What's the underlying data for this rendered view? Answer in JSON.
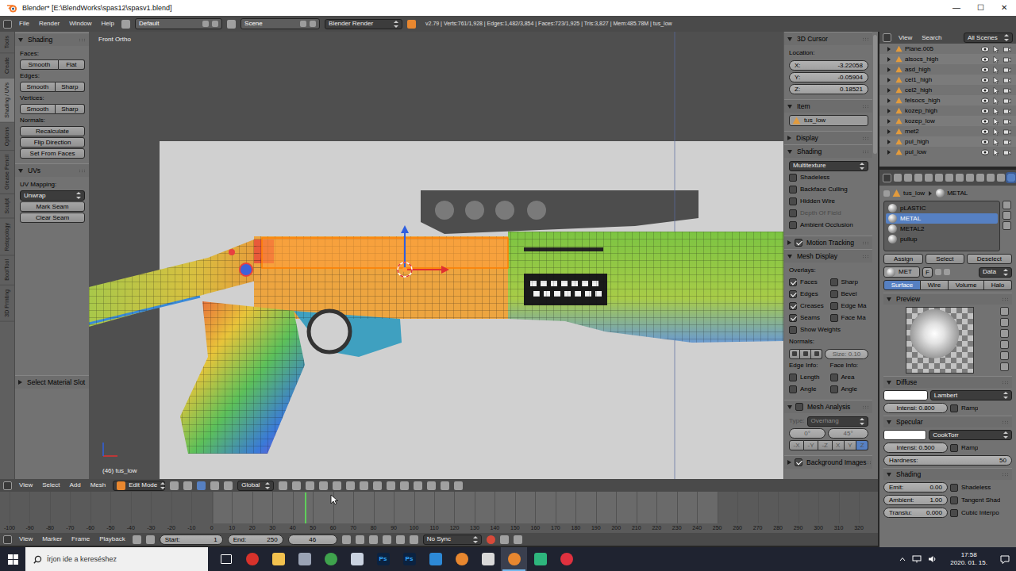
{
  "window": {
    "title": "Blender* [E:\\BlendWorks\\spas12\\spasv1.blend]",
    "controls": [
      "—",
      "☐",
      "✕"
    ]
  },
  "info_header": {
    "menus": [
      "File",
      "Render",
      "Window",
      "Help"
    ],
    "screen_layout": "Default",
    "scene": "Scene",
    "engine": "Blender Render",
    "stats": "v2.79 | Verts:761/1,928 | Edges:1,482/3,854 | Faces:723/1,925 | Tris:3,827 | Mem:485.78M | tus_low"
  },
  "tool_shelf": {
    "tabs": [
      {
        "label": "Tools",
        "selected": false
      },
      {
        "label": "Create",
        "selected": false
      },
      {
        "label": "Shading / UVs",
        "selected": true
      },
      {
        "label": "Options",
        "selected": false
      },
      {
        "label": "Grease Pencil",
        "selected": false
      },
      {
        "label": "Sculpt",
        "selected": false
      },
      {
        "label": "Retopology",
        "selected": false
      },
      {
        "label": "BoolTool",
        "selected": false
      },
      {
        "label": "3D Printing",
        "selected": false
      }
    ],
    "panels": [
      {
        "title": "Shading",
        "expanded": true,
        "rows": [
          {
            "kind": "label",
            "text": "Faces:"
          },
          {
            "kind": "buttons",
            "items": [
              "Smooth",
              "Flat"
            ]
          },
          {
            "kind": "label",
            "text": "Edges:"
          },
          {
            "kind": "buttons",
            "items": [
              "Smooth",
              "Sharp"
            ]
          },
          {
            "kind": "label",
            "text": "Vertices:"
          },
          {
            "kind": "buttons",
            "items": [
              "Smooth",
              "Sharp"
            ]
          },
          {
            "kind": "label",
            "text": "Normals:"
          },
          {
            "kind": "button",
            "text": "Recalculate"
          },
          {
            "kind": "button",
            "text": "Flip Direction"
          },
          {
            "kind": "button",
            "text": "Set From Faces"
          }
        ]
      },
      {
        "title": "UVs",
        "expanded": true,
        "rows": [
          {
            "kind": "label",
            "text": "UV Mapping:"
          },
          {
            "kind": "menu",
            "text": "Unwrap"
          },
          {
            "kind": "button",
            "text": "Mark Seam"
          },
          {
            "kind": "button",
            "text": "Clear Seam"
          }
        ]
      }
    ],
    "operator_panel": {
      "title": "Select Material Slot",
      "expanded": false
    }
  },
  "viewport": {
    "view_name": "Front Ortho",
    "object_info": "(46) tus_low"
  },
  "n_panel": {
    "panels": [
      {
        "title": "3D Cursor",
        "expanded": true,
        "rows": [
          {
            "kind": "label",
            "text": "Location:",
            "disabled": false
          },
          {
            "kind": "field",
            "label": "X:",
            "value": "-3.22058",
            "disabled": false
          },
          {
            "kind": "field",
            "label": "Y:",
            "value": "-0.05904",
            "disabled": false
          },
          {
            "kind": "field",
            "label": "Z:",
            "value": "0.18521",
            "disabled": false
          }
        ]
      },
      {
        "title": "Item",
        "expanded": true,
        "rows": [
          {
            "kind": "input",
            "value": "tus_low",
            "disabled": false
          }
        ]
      },
      {
        "title": "Display",
        "expanded": false,
        "rows": []
      },
      {
        "title": "Shading",
        "expanded": true,
        "rows": [
          {
            "kind": "dropdown",
            "value": "Multitexture",
            "disabled": false
          },
          {
            "kind": "check",
            "label": "Shadeless",
            "checked": false,
            "disabled": false
          },
          {
            "kind": "check",
            "label": "Backface Culling",
            "checked": false,
            "disabled": false
          },
          {
            "kind": "check",
            "label": "Hidden Wire",
            "checked": false,
            "disabled": false
          },
          {
            "kind": "check",
            "label": "Depth Of Field",
            "checked": false,
            "disabled": true
          },
          {
            "kind": "check",
            "label": "Ambient Occlusion",
            "checked": false,
            "disabled": false
          }
        ]
      },
      {
        "title": "Motion Tracking",
        "expanded": false,
        "checkbox": {
          "checked": true
        },
        "rows": []
      },
      {
        "title": "Mesh Display",
        "expanded": true,
        "rows": [
          {
            "kind": "label",
            "text": "Overlays:",
            "disabled": false
          },
          {
            "kind": "check2",
            "items": [
              {
                "label": "Faces",
                "checked": true
              },
              {
                "label": "Sharp",
                "checked": false
              }
            ],
            "disabled": false
          },
          {
            "kind": "check2",
            "items": [
              {
                "label": "Edges",
                "checked": true
              },
              {
                "label": "Bevel",
                "checked": false
              }
            ],
            "disabled": false
          },
          {
            "kind": "check2",
            "items": [
              {
                "label": "Creases",
                "checked": true
              },
              {
                "label": "Edge Ma",
                "checked": false
              }
            ],
            "disabled": false
          },
          {
            "kind": "check2",
            "items": [
              {
                "label": "Seams",
                "checked": true
              },
              {
                "label": "Face Ma",
                "checked": false
              }
            ],
            "disabled": false
          },
          {
            "kind": "check",
            "label": "Show Weights",
            "checked": false,
            "disabled": false
          },
          {
            "kind": "label",
            "text": "Normals:",
            "disabled": false
          },
          {
            "kind": "normals",
            "value": "Size: 0.10",
            "disabled": true
          },
          {
            "kind": "pair",
            "items": [
              "Edge Info:",
              "Face Info:"
            ],
            "disabled": false
          },
          {
            "kind": "check2",
            "items": [
              {
                "label": "Length",
                "checked": false
              },
              {
                "label": "Area",
                "checked": false
              }
            ],
            "disabled": false
          },
          {
            "kind": "check2",
            "items": [
              {
                "label": "Angle",
                "checked": false
              },
              {
                "label": "Angle",
                "checked": false
              }
            ],
            "disabled": false
          }
        ]
      },
      {
        "title": "Mesh Analysis",
        "expanded": true,
        "checkbox": {
          "checked": false
        },
        "rows": [
          {
            "kind": "labeled-dropdown",
            "label": "Type:",
            "value": "Overhang",
            "disabled": true
          },
          {
            "kind": "fields2",
            "items": [
              "0°",
              "45°"
            ],
            "disabled": true
          },
          {
            "kind": "buttons",
            "items": [
              {
                "label": "-X",
                "selected": false
              },
              {
                "label": "-Y",
                "selected": false
              },
              {
                "label": "-Z",
                "selected": false
              },
              {
                "label": "X",
                "selected": false
              },
              {
                "label": "Y",
                "selected": false
              },
              {
                "label": "Z",
                "selected": true
              }
            ],
            "disabled": true
          }
        ]
      },
      {
        "title": "Background Images",
        "expanded": false,
        "checkbox": {
          "checked": true
        },
        "rows": []
      }
    ]
  },
  "viewport_header": {
    "menus": [
      "View",
      "Select",
      "Add",
      "Mesh"
    ],
    "mode": "Edit Mode",
    "orientation": "Global"
  },
  "timeline": {
    "ruler": {
      "min": -100,
      "max": 320,
      "ticks": [
        "-100",
        "-90",
        "-80",
        "-70",
        "-60",
        "-50",
        "-40",
        "-30",
        "-20",
        "-10",
        "0",
        "10",
        "20",
        "30",
        "40",
        "50",
        "60",
        "70",
        "80",
        "90",
        "100",
        "110",
        "120",
        "130",
        "140",
        "150",
        "160",
        "170",
        "180",
        "190",
        "200",
        "210",
        "220",
        "230",
        "240",
        "250",
        "260",
        "270",
        "280",
        "290",
        "300",
        "310",
        "320"
      ]
    }
  },
  "timeline_header": {
    "menus": [
      "View",
      "Marker",
      "Frame",
      "Playback"
    ],
    "start_label": "Start:",
    "start": "1",
    "end_label": "End:",
    "end": "250",
    "frame": "46",
    "sync": "No Sync"
  },
  "outliner": {
    "menus": [
      "View",
      "Search"
    ],
    "filter": "All Scenes",
    "items": [
      {
        "name": "Plane.005",
        "expanded": false
      },
      {
        "name": "alsocs_high",
        "expanded": false
      },
      {
        "name": "asd_high",
        "expanded": false
      },
      {
        "name": "cel1_high",
        "expanded": false
      },
      {
        "name": "cel2_high",
        "expanded": false
      },
      {
        "name": "felsocs_high",
        "expanded": false
      },
      {
        "name": "kozep_high",
        "expanded": false
      },
      {
        "name": "kozep_low",
        "expanded": false
      },
      {
        "name": "met2",
        "expanded": false
      },
      {
        "name": "pul_high",
        "expanded": false
      },
      {
        "name": "pul_low",
        "expanded": false
      }
    ]
  },
  "properties": {
    "context_tabs": [
      {
        "selected": false
      },
      {
        "selected": false
      },
      {
        "selected": false
      },
      {
        "selected": false
      },
      {
        "selected": false
      },
      {
        "selected": false
      },
      {
        "selected": false
      },
      {
        "selected": false
      },
      {
        "selected": false
      },
      {
        "selected": false
      },
      {
        "selected": false
      },
      {
        "selected": true
      },
      {
        "selected": false
      }
    ],
    "breadcrumb": {
      "object": "tus_low",
      "material": "METAL"
    },
    "material_slots": [
      {
        "name": "pLASTIC",
        "selected": false
      },
      {
        "name": "METAL",
        "selected": true
      },
      {
        "name": "METAL2",
        "selected": false
      },
      {
        "name": "pullup",
        "selected": false
      }
    ],
    "slot_buttons": [
      "Assign",
      "Select",
      "Deselect"
    ],
    "datablock": {
      "name": "MET",
      "fake_user": "F",
      "link": "Data"
    },
    "material_tabs": [
      {
        "label": "Surface",
        "selected": true
      },
      {
        "label": "Wire",
        "selected": false
      },
      {
        "label": "Volume",
        "selected": false
      },
      {
        "label": "Halo",
        "selected": false
      }
    ],
    "preview": {
      "title": "Preview",
      "expanded": true
    },
    "diffuse": {
      "title": "Diffuse",
      "expanded": true,
      "shader": "Lambert",
      "intensity": "Intensi: 0.800",
      "ramp": {
        "label": "Ramp",
        "checked": false
      }
    },
    "specular": {
      "title": "Specular",
      "expanded": true,
      "shader": "CookTorr",
      "intensity": "Intensi: 0.500",
      "ramp": {
        "label": "Ramp",
        "checked": false
      },
      "hardness_label": "Hardness:",
      "hardness": "50"
    },
    "shading": {
      "title": "Shading",
      "expanded": true,
      "fields": [
        {
          "label": "Emit:",
          "value": "0.00"
        },
        {
          "label": "Ambient:",
          "value": "1.00"
        },
        {
          "label": "Translu:",
          "value": "0.000"
        }
      ],
      "checks": [
        {
          "label": "Shadeless",
          "checked": false
        },
        {
          "label": "Tangent Shad",
          "checked": false
        },
        {
          "label": "Cubic Interpo",
          "checked": false
        }
      ]
    }
  },
  "taskbar": {
    "search": "Írjon ide a kereséshez",
    "time": "17:58",
    "date": "2020. 01. 15.",
    "apps": [
      {
        "kind": "outline",
        "color": "#ffffff",
        "active": false
      },
      {
        "kind": "round",
        "color": "#d8322b",
        "active": false
      },
      {
        "kind": "tile",
        "color": "#f2c14e",
        "active": false
      },
      {
        "kind": "tile",
        "color": "#9aa3b5",
        "active": false
      },
      {
        "kind": "round",
        "color": "#3fa34d",
        "active": false
      },
      {
        "kind": "tile",
        "color": "#c9d2e0",
        "active": false
      },
      {
        "kind": "badge",
        "label": "Ps",
        "color": "#0b2240",
        "active": false
      },
      {
        "kind": "badge",
        "label": "Ps",
        "color": "#0b2240",
        "active": false
      },
      {
        "kind": "tile",
        "color": "#2d89d6",
        "active": false
      },
      {
        "kind": "round",
        "color": "#e8872f",
        "active": false
      },
      {
        "kind": "tile",
        "color": "#d9d9d9",
        "active": false
      },
      {
        "kind": "round",
        "color": "#e8872f",
        "active": true
      },
      {
        "kind": "tile",
        "color": "#2eb67d",
        "active": false
      },
      {
        "kind": "round",
        "color": "#e0313f",
        "active": false
      }
    ]
  }
}
